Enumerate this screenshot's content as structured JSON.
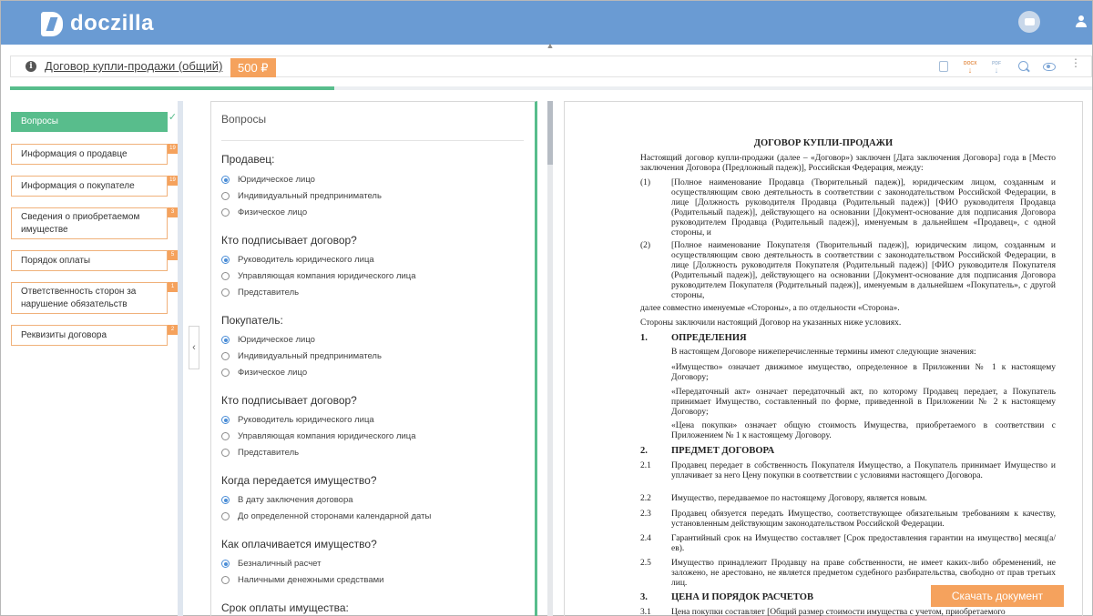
{
  "app": {
    "brand": "doczilla"
  },
  "header": {
    "title": "Договор купли-продажи (общий)",
    "price": "500 ₽",
    "toolbar": {
      "docx_label": "DOCX",
      "pdf_label": "PDF"
    },
    "progress": 0.3
  },
  "sidebar": {
    "items": [
      {
        "label": "Вопросы",
        "badge": "",
        "active": true
      },
      {
        "label": "Информация о продавце",
        "badge": "19"
      },
      {
        "label": "Информация о покупателе",
        "badge": "19"
      },
      {
        "label": "Сведения о приобретаемом имуществе",
        "badge": "3"
      },
      {
        "label": "Порядок оплаты",
        "badge": "5"
      },
      {
        "label": "Ответственность сторон за нарушение обязательств",
        "badge": "1"
      },
      {
        "label": "Реквизиты договора",
        "badge": "2"
      }
    ]
  },
  "questions": {
    "heading": "Вопросы",
    "groups": [
      {
        "title": "Продавец:",
        "options": [
          "Юридическое лицо",
          "Индивидуальный предприниматель",
          "Физическое лицо"
        ],
        "selected": 0
      },
      {
        "title": "Кто подписывает договор?",
        "options": [
          "Руководитель юридического лица",
          "Управляющая компания юридического лица",
          "Представитель"
        ],
        "selected": 0
      },
      {
        "title": "Покупатель:",
        "options": [
          "Юридическое лицо",
          "Индивидуальный предприниматель",
          "Физическое лицо"
        ],
        "selected": 0
      },
      {
        "title": "Кто подписывает договор?",
        "options": [
          "Руководитель юридического лица",
          "Управляющая компания юридического лица",
          "Представитель"
        ],
        "selected": 0
      },
      {
        "title": "Когда передается имущество?",
        "options": [
          "В дату заключения договора",
          "До определенной сторонами календарной даты"
        ],
        "selected": 0
      },
      {
        "title": "Как оплачивается имущество?",
        "options": [
          "Безналичный расчет",
          "Наличными денежными средствами"
        ],
        "selected": 0
      },
      {
        "title": "Срок оплаты имущества:",
        "options": [],
        "selected": -1
      }
    ]
  },
  "document": {
    "title": "ДОГОВОР КУПЛИ-ПРОДАЖИ",
    "intro": "Настоящий договор купли-продажи (далее – «Договор») заключен [Дата заключения Договора] года в [Место заключения Договора (Предложный падеж)], Российская Федерация, между:",
    "parties": [
      {
        "num": "(1)",
        "text": "[Полное наименование Продавца (Творительный падеж)], юридическим лицом, созданным и осуществляющим свою деятельность в соответствии с законодательством Российской Федерации, в лице [Должность руководителя Продавца (Родительный падеж)] [ФИО руководителя Продавца (Родительный падеж)], действующего на основании [Документ-основание для подписания Договора руководителем Продавца (Родительный падеж)], именуемым в дальнейшем «Продавец», с одной стороны, и"
      },
      {
        "num": "(2)",
        "text": "[Полное наименование Покупателя (Творительный падеж)], юридическим лицом, созданным и осуществляющим свою деятельность в соответствии с законодательством Российской Федерации, в лице [Должность руководителя Покупателя (Родительный падеж)] [ФИО руководителя Покупателя (Родительный падеж)], действующего на основании [Документ-основание для подписания Договора руководителем Покупателя (Родительный падеж)], именуемым в дальнейшем «Покупатель», с другой стороны,"
      }
    ],
    "jointly": "далее совместно именуемые «Стороны», а по отдельности «Сторона».",
    "agreed": "Стороны заключили настоящий Договор на указанных ниже условиях.",
    "sections": [
      {
        "num": "1.",
        "title": "ОПРЕДЕЛЕНИЯ",
        "paras": [
          "В настоящем Договоре нижеперечисленные термины имеют следующие значения:",
          "«Имущество» означает движимое имущество, определенное в Приложении № 1 к настоящему Договору;",
          "«Передаточный акт» означает передаточный акт, по которому Продавец передает, а Покупатель принимает Имущество, составленный по форме, приведенной в Приложении № 2 к настоящему Договору;",
          "«Цена покупки» означает общую стоимость Имущества, приобретаемого в соответствии с Приложением № 1 к настоящему Договору."
        ]
      },
      {
        "num": "2.",
        "title": "ПРЕДМЕТ ДОГОВОРА",
        "clauses": [
          {
            "num": "2.1",
            "text": "Продавец передает в собственность Покупателя Имущество, а Покупатель принимает Имущество и уплачивает за него Цену покупки в соответствии с условиями настоящего Договора."
          },
          {
            "num": "2.2",
            "text": "Имущество, передаваемое по настоящему Договору, является новым."
          },
          {
            "num": "2.3",
            "text": "Продавец обязуется передать Имущество, соответствующее обязательным требованиям к качеству, установленным действующим законодательством Российской Федерации."
          },
          {
            "num": "2.4",
            "text": "Гарантийный срок на Имущество составляет [Срок предоставления гарантии на имущество] месяц(а/ев)."
          },
          {
            "num": "2.5",
            "text": "Имущество принадлежит Продавцу на праве собственности, не имеет каких-либо обременений, не заложено, не арестовано, не является предметом судебного разбирательства, свободно от прав третьих лиц."
          }
        ]
      },
      {
        "num": "3.",
        "title": "ЦЕНА И ПОРЯДОК РАСЧЕТОВ",
        "clauses": [
          {
            "num": "3.1",
            "text": "Цена покупки составляет [Общий размер стоимости имущества с учетом, приобретаемого"
          }
        ]
      }
    ],
    "download_label": "Скачать документ"
  }
}
